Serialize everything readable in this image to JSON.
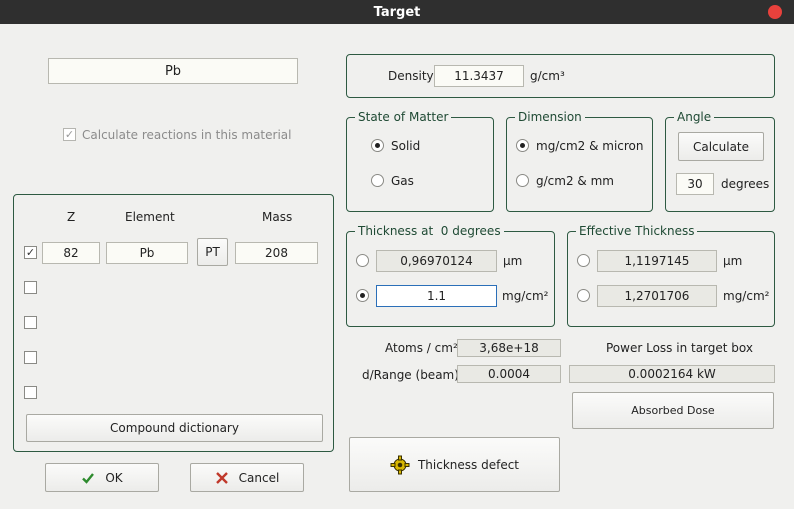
{
  "window": {
    "title": "Target"
  },
  "material": {
    "name": "Pb",
    "calc_reactions_label": "Calculate reactions in this material",
    "calc_reactions_checked": true
  },
  "composition": {
    "headers": {
      "z": "Z",
      "element": "Element",
      "mass": "Mass"
    },
    "row1": {
      "checked": true,
      "z": "82",
      "element": "Pb",
      "pt_button": "PT",
      "mass": "208"
    },
    "empty_rows": 4,
    "compound_dictionary_label": "Compound dictionary"
  },
  "footer": {
    "ok_label": "OK",
    "cancel_label": "Cancel"
  },
  "density": {
    "label": "Density",
    "value": "11.3437",
    "unit": "g/cm³"
  },
  "state_of_matter": {
    "title": "State of Matter",
    "options": [
      "Solid",
      "Gas"
    ],
    "selected": "Solid"
  },
  "dimension": {
    "title": "Dimension",
    "options": [
      "mg/cm2 & micron",
      "g/cm2 & mm"
    ],
    "selected": "mg/cm2 & micron"
  },
  "angle": {
    "title": "Angle",
    "calculate_label": "Calculate",
    "value": "30",
    "unit": "degrees"
  },
  "thickness": {
    "title": "Thickness at  0 degrees",
    "um_value": "0,96970124",
    "um_unit": "µm",
    "mg_value": "1.1",
    "mg_unit": "mg/cm²",
    "selected": "mg"
  },
  "effective_thickness": {
    "title": "Effective Thickness",
    "um_value": "1,1197145",
    "um_unit": "µm",
    "mg_value": "1,2701706",
    "mg_unit": "mg/cm²"
  },
  "atoms": {
    "label": "Atoms / cm²",
    "value": "3,68e+18"
  },
  "d_range": {
    "label": "d/Range (beam)",
    "value": "0.0004"
  },
  "power_loss": {
    "label": "Power Loss in target box",
    "value": "0.0002164 kW"
  },
  "absorbed_dose_label": "Absorbed Dose",
  "thickness_defect_label": "Thickness defect",
  "icons": {
    "ok": "check-icon",
    "cancel": "cancel-x-icon",
    "defect": "gear-icon",
    "close": "close-icon"
  },
  "colors": {
    "titlebar": "#2f2f2f",
    "close": "#e8413c",
    "group_border": "#2e5a42",
    "accent": "#2b6fb8"
  }
}
